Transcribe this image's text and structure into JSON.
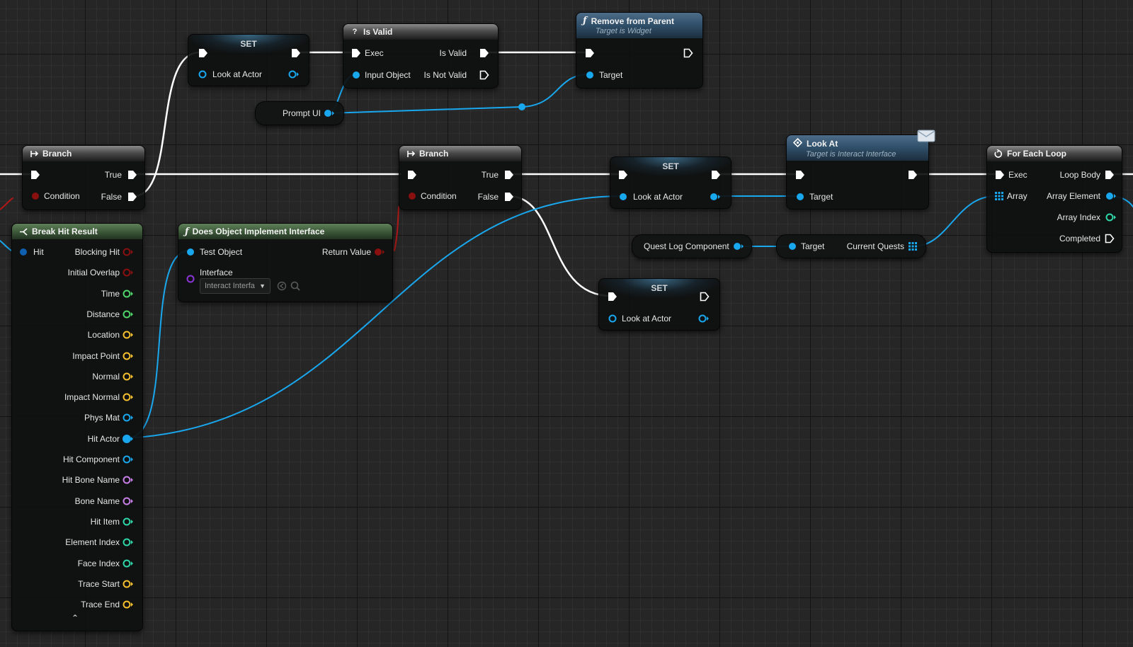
{
  "nodes": {
    "set_top": {
      "title": "SET",
      "var": "Look at Actor"
    },
    "is_valid": {
      "title": "Is Valid",
      "exec_in": "Exec",
      "input": "Input Object",
      "out_valid": "Is Valid",
      "out_not_valid": "Is Not Valid"
    },
    "remove_from_parent": {
      "title": "Remove from Parent",
      "subtitle": "Target is Widget",
      "target": "Target"
    },
    "prompt_ui": {
      "label": "Prompt UI"
    },
    "branch_left": {
      "title": "Branch",
      "condition": "Condition",
      "true": "True",
      "false": "False"
    },
    "branch_mid": {
      "title": "Branch",
      "condition": "Condition",
      "true": "True",
      "false": "False"
    },
    "set_mid": {
      "title": "SET",
      "var": "Look at Actor"
    },
    "set_low": {
      "title": "SET",
      "var": "Look at Actor"
    },
    "look_at": {
      "title": "Look At",
      "subtitle": "Target is Interact Interface",
      "target": "Target"
    },
    "for_each": {
      "title": "For Each Loop",
      "exec": "Exec",
      "array": "Array",
      "loop_body": "Loop Body",
      "array_element": "Array Element",
      "array_index": "Array Index",
      "completed": "Completed"
    },
    "quest_log": {
      "label": "Quest Log Component"
    },
    "current_quests": {
      "target": "Target",
      "output": "Current Quests"
    },
    "does_implement": {
      "title": "Does Object Implement Interface",
      "test_object": "Test Object",
      "interface": "Interface",
      "interface_value": "Interact Interfa",
      "return_value": "Return Value"
    },
    "break_hit": {
      "title": "Break Hit Result",
      "input": "Hit",
      "outputs": [
        {
          "label": "Blocking Hit",
          "color": "#8a0f0f"
        },
        {
          "label": "Initial Overlap",
          "color": "#8a0f0f"
        },
        {
          "label": "Time",
          "color": "#4fd66a"
        },
        {
          "label": "Distance",
          "color": "#4fd66a"
        },
        {
          "label": "Location",
          "color": "#f5c02e"
        },
        {
          "label": "Impact Point",
          "color": "#f5c02e"
        },
        {
          "label": "Normal",
          "color": "#f5c02e"
        },
        {
          "label": "Impact Normal",
          "color": "#f5c02e"
        },
        {
          "label": "Phys Mat",
          "color": "#19a7ee"
        },
        {
          "label": "Hit Actor",
          "color": "#19a7ee"
        },
        {
          "label": "Hit Component",
          "color": "#19a7ee"
        },
        {
          "label": "Hit Bone Name",
          "color": "#c77ee6"
        },
        {
          "label": "Bone Name",
          "color": "#c77ee6"
        },
        {
          "label": "Hit Item",
          "color": "#2fd6a7"
        },
        {
          "label": "Element Index",
          "color": "#2fd6a7"
        },
        {
          "label": "Face Index",
          "color": "#2fd6a7"
        },
        {
          "label": "Trace Start",
          "color": "#f5c02e"
        },
        {
          "label": "Trace End",
          "color": "#f5c02e"
        }
      ]
    }
  },
  "colors": {
    "exec": "#ffffff",
    "object": "#19a7ee",
    "bool": "#8a0f0f",
    "float": "#4fd66a",
    "vector": "#f5c02e",
    "name": "#c77ee6",
    "int": "#2fd6a7",
    "interface": "#8a35d6"
  },
  "icons": [
    "function-icon",
    "question-icon",
    "branch-icon",
    "break-struct-icon",
    "interface-message-icon",
    "loop-icon",
    "envelope-icon",
    "array-grid-icon",
    "chevron-up-icon",
    "chevron-down-icon",
    "search-icon",
    "use-selected-icon"
  ]
}
